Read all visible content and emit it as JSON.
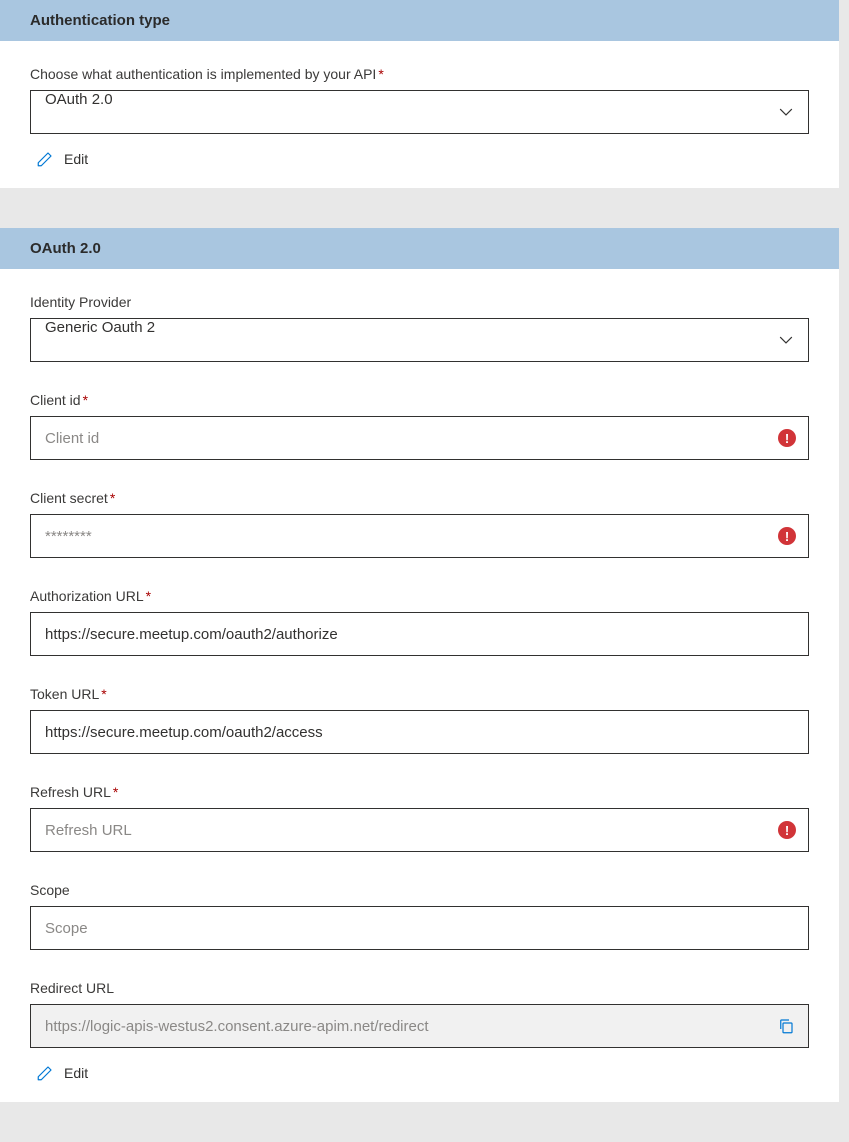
{
  "panels": {
    "auth_type": {
      "title": "Authentication type",
      "chooseLabel": "Choose what authentication is implemented by your API",
      "selected": "OAuth 2.0",
      "editLabel": "Edit"
    },
    "oauth": {
      "title": "OAuth 2.0",
      "identityProvider": {
        "label": "Identity Provider",
        "value": "Generic Oauth 2"
      },
      "clientId": {
        "label": "Client id",
        "placeholder": "Client id",
        "value": ""
      },
      "clientSecret": {
        "label": "Client secret",
        "placeholder": "********",
        "value": ""
      },
      "authUrl": {
        "label": "Authorization URL",
        "value": "https://secure.meetup.com/oauth2/authorize"
      },
      "tokenUrl": {
        "label": "Token URL",
        "value": "https://secure.meetup.com/oauth2/access"
      },
      "refreshUrl": {
        "label": "Refresh URL",
        "placeholder": "Refresh URL",
        "value": ""
      },
      "scope": {
        "label": "Scope",
        "placeholder": "Scope",
        "value": ""
      },
      "redirectUrl": {
        "label": "Redirect URL",
        "value": "https://logic-apis-westus2.consent.azure-apim.net/redirect"
      },
      "editLabel": "Edit"
    }
  }
}
